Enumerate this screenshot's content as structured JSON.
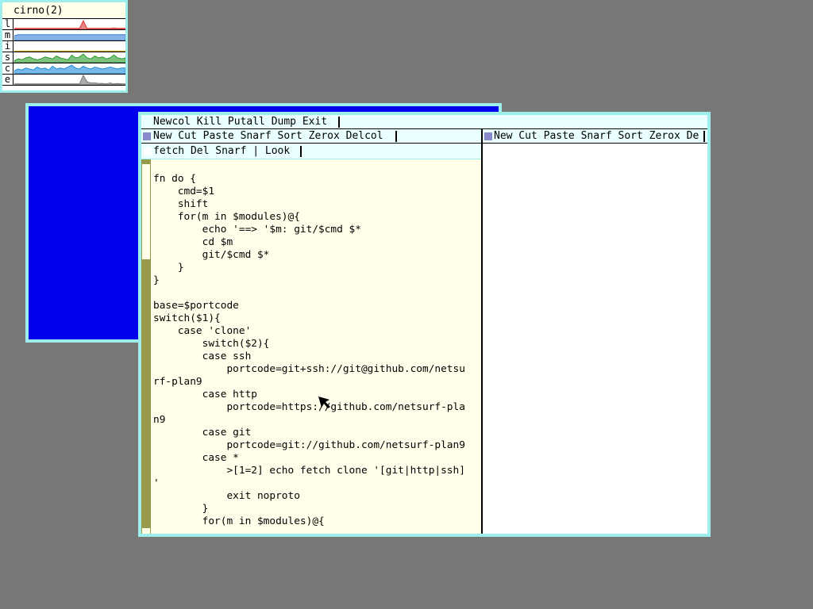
{
  "stats": {
    "title": "cirno(2)",
    "rows": [
      {
        "label": "l",
        "color": "#d33"
      },
      {
        "label": "m",
        "color": "#3a7fd8"
      },
      {
        "label": "i",
        "color": "#c9a400"
      },
      {
        "label": "s",
        "color": "#2a9a2a"
      },
      {
        "label": "c",
        "color": "#1a8ad8"
      },
      {
        "label": "e",
        "color": "#777777"
      }
    ]
  },
  "acme": {
    "row_tag": "Newcol Kill Putall Dump Exit",
    "col1_tag": "New Cut Paste Snarf Sort Zerox Delcol",
    "col2_tag": "New Cut Paste Snarf Sort Zerox De",
    "win_tag": "fetch Del Snarf | Look",
    "code": "fn do {\n    cmd=$1\n    shift\n    for(m in $modules)@{\n        echo '==> '$m: git/$cmd $*\n        cd $m\n        git/$cmd $*\n    }\n}\n\nbase=$portcode\nswitch($1){\n    case 'clone'\n        switch($2){\n        case ssh\n            portcode=git+ssh://git@github.com/netsu\nrf-plan9\n        case http\n            portcode=https://github.com/netsurf-pla\nn9\n        case git\n            portcode=git://github.com/netsurf-plan9\n        case *\n            >[1=2] echo fetch clone '[git|http|ssh]\n'\n            exit noproto\n        }\n        for(m in $modules)@{"
  },
  "colors": {
    "background": "#777775",
    "border": "#9eeeee",
    "tag_bg": "#eaffff",
    "body_bg": "#ffffea",
    "scrollbar": "#99994c",
    "blue_window": "#0000ee"
  }
}
